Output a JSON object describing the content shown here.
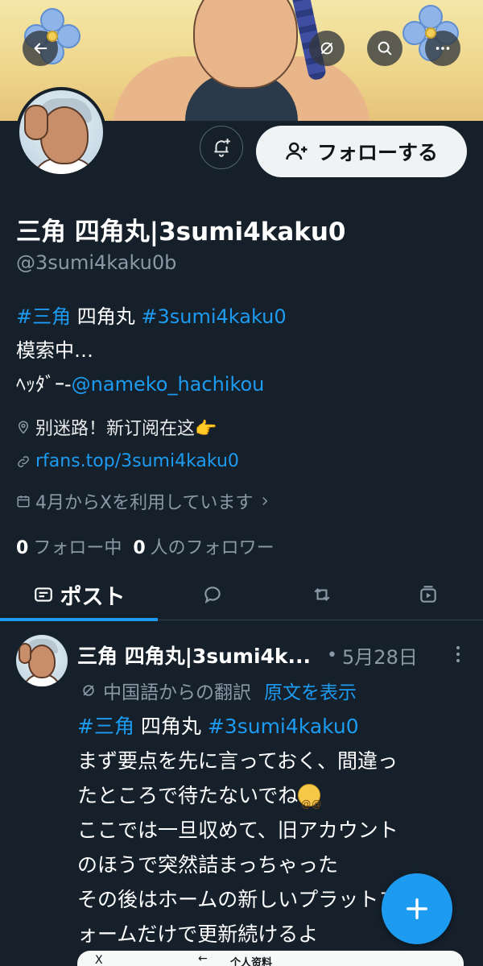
{
  "profile": {
    "display_name": "三角 四角丸|3sumi4kaku0",
    "handle": "@3sumi4kaku0b",
    "follow_label": "フォローする",
    "bio": {
      "hashtag1": "#三角",
      "plain1": " 四角丸 ",
      "hashtag2": "#3sumi4kaku0",
      "line2": "模索中…",
      "header_prefix": "ﾍｯﾀﾞｰ",
      "header_credit": "@nameko_hachikou"
    },
    "location": "别迷路！新订阅在这👉",
    "website": "rfans.top/3sumi4kaku0",
    "joined": "4月からXを利用しています",
    "following_count": "0",
    "following_label": "フォロー中",
    "followers_count": "0",
    "followers_label": "人のフォロワー"
  },
  "tabs": {
    "posts_label": "ポスト",
    "items": [
      "posts",
      "replies",
      "reposts",
      "media"
    ]
  },
  "post": {
    "author": "三角 四角丸|3sumi4k...",
    "dot": "•",
    "date": "5月28日",
    "translated_from": "中国語からの翻訳",
    "show_original": "原文を表示",
    "body": {
      "hashtag1": "#三角",
      "plain1": " 四角丸 ",
      "hashtag2": "#3sumi4kaku0",
      "line2": "まず要点を先に言っておく、間違っ",
      "line3": "たところで待たないでね",
      "line4": "ここでは一旦収めて、旧アカウント",
      "line5": "のほうで突然詰まっちゃった",
      "line6": "その後はホームの新しいプラットフ",
      "line7": "ォームだけで更新続けるよ"
    },
    "preview": {
      "logo": "X",
      "back": "←",
      "title": "个人资料"
    }
  },
  "colors": {
    "background": "#15202b",
    "accent": "#1d9bf0",
    "secondary_text": "#8b98a5",
    "follow_button_bg": "#eff3f4"
  },
  "icons": [
    "back-arrow-icon",
    "translate-icon",
    "search-icon",
    "more-icon",
    "bell-plus-icon",
    "person-plus-icon",
    "location-icon",
    "link-icon",
    "calendar-icon",
    "chevron-right-icon",
    "post-tab-icon",
    "reply-icon",
    "repost-icon",
    "media-icon",
    "translate-small-icon",
    "kebab-icon",
    "compose-plus-icon"
  ]
}
